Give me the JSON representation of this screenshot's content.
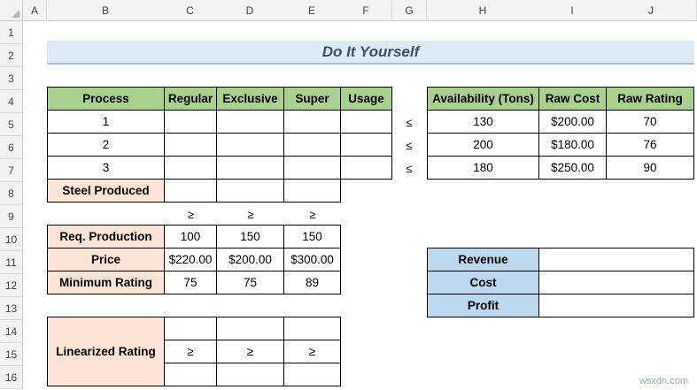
{
  "columns": [
    "A",
    "B",
    "C",
    "D",
    "E",
    "F",
    "G",
    "H",
    "I",
    "J"
  ],
  "rows": [
    "1",
    "2",
    "3",
    "4",
    "5",
    "6",
    "7",
    "8",
    "9",
    "10",
    "11",
    "12",
    "13",
    "14",
    "15",
    "16"
  ],
  "title": "Do It Yourself",
  "process_table": {
    "headers": [
      "Process",
      "Regular",
      "Exclusive",
      "Super",
      "Usage"
    ],
    "rows": [
      "1",
      "2",
      "3"
    ],
    "steel_produced_label": "Steel Produced"
  },
  "inequality_le": "≤",
  "inequality_ge": "≥",
  "availability_table": {
    "headers": [
      "Availability (Tons)",
      "Raw Cost",
      "Raw Rating"
    ],
    "rows": [
      [
        "130",
        "$200.00",
        "70"
      ],
      [
        "200",
        "$180.00",
        "76"
      ],
      [
        "180",
        "$250.00",
        "90"
      ]
    ]
  },
  "requirements_table": {
    "rows": [
      {
        "label": "Req. Production",
        "values": [
          "100",
          "150",
          "150"
        ]
      },
      {
        "label": "Price",
        "values": [
          "$220.00",
          "$200.00",
          "$300.00"
        ]
      },
      {
        "label": "Minimum Rating",
        "values": [
          "75",
          "75",
          "89"
        ]
      }
    ]
  },
  "summary_table": {
    "labels": [
      "Revenue",
      "Cost",
      "Profit"
    ]
  },
  "linearized_table": {
    "label": "Linearized Rating"
  },
  "watermark": "wsxdn.com"
}
